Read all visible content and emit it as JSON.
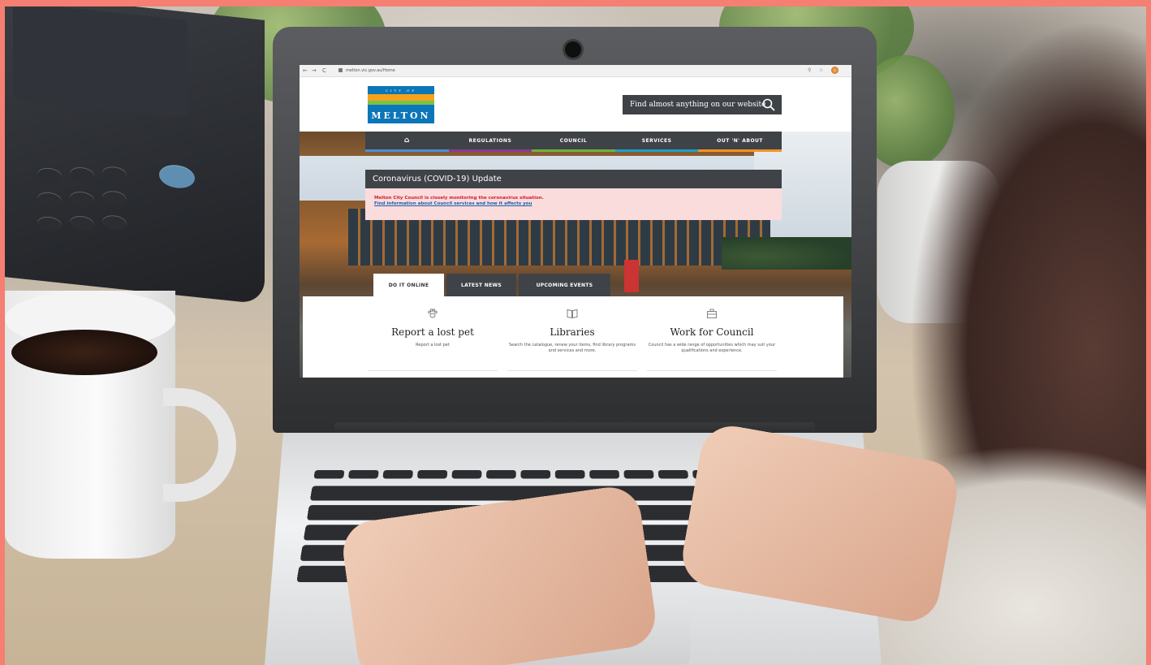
{
  "browser": {
    "back": "←",
    "forward": "→",
    "reload": "C",
    "url": "melton.vic.gov.au/Home"
  },
  "site": {
    "logo": {
      "top": "CITY OF",
      "name": "MELTON"
    },
    "search": {
      "placeholder": "Find almost anything on our website",
      "icon": "search-icon"
    },
    "nav": {
      "home_icon": "home-icon",
      "items": [
        "REGULATIONS",
        "COUNCIL",
        "SERVICES",
        "OUT 'N' ABOUT"
      ]
    },
    "alert": {
      "title": "Coronavirus (COVID-19) Update",
      "line1": "Melton City Council is closely monitoring the coronavirus situation.",
      "line2": "Find information about Council services and how it affects you"
    },
    "tabs": [
      "DO IT ONLINE",
      "LATEST NEWS",
      "UPCOMING EVENTS"
    ],
    "cards": [
      {
        "icon": "paw-icon",
        "title": "Report a lost pet",
        "desc": "Report a lost pet"
      },
      {
        "icon": "book-icon",
        "title": "Libraries",
        "desc": "Search the catalogue, renew your items, find library programs and services and more."
      },
      {
        "icon": "briefcase-icon",
        "title": "Work for Council",
        "desc": "Council has a wide range of opportunities which may suit your qualifications and experience."
      }
    ]
  },
  "colors": {
    "frame": "#f47f72",
    "dark": "#3f4347",
    "alert_bg": "#fbdcdc",
    "alert_red": "#d01c2a",
    "link_blue": "#1a5fb0",
    "logo_blue": "#0b76b8"
  }
}
